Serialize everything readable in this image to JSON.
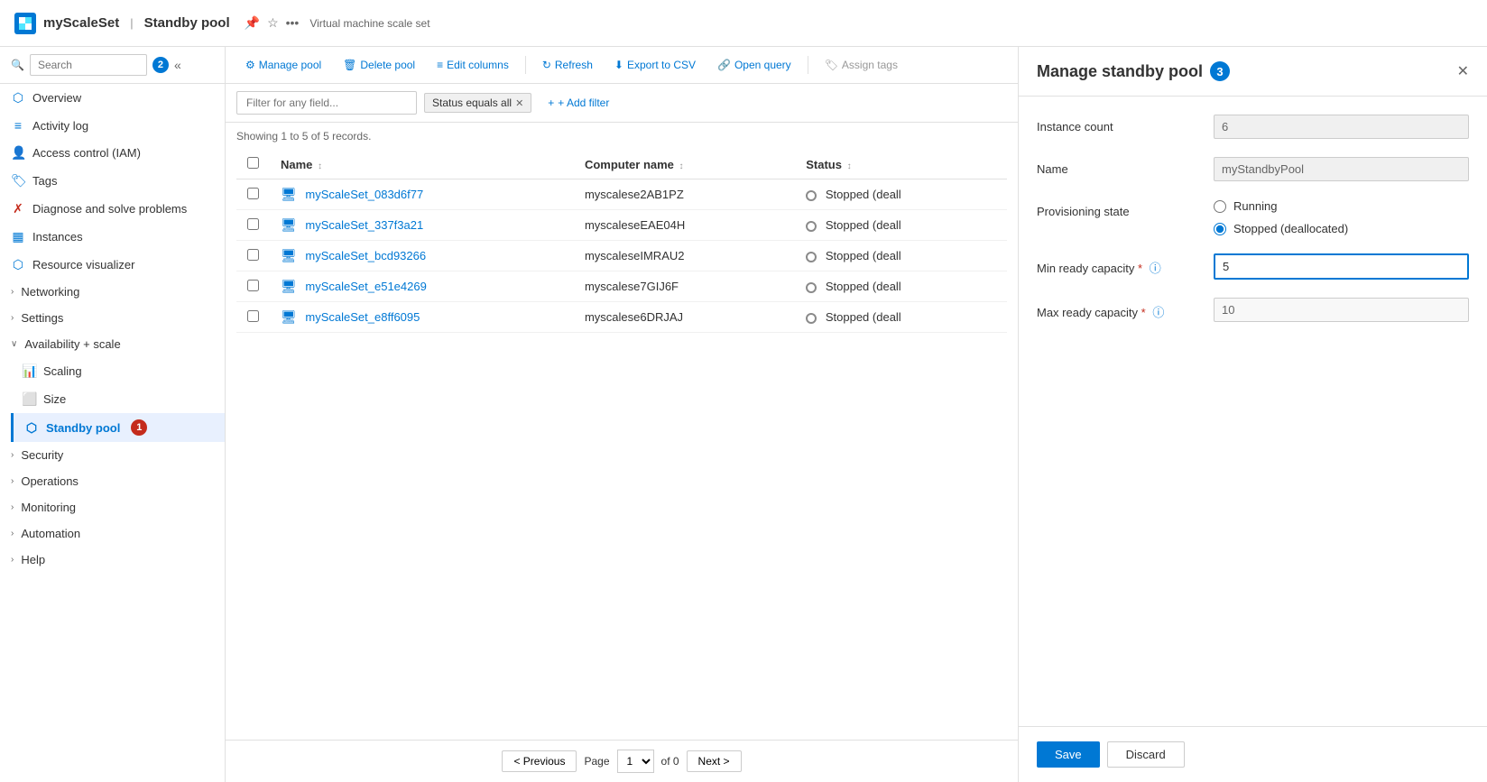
{
  "header": {
    "title": "myScaleSet",
    "separator": "|",
    "section": "Standby pool",
    "subtitle": "Virtual machine scale set",
    "badge2_label": "2"
  },
  "sidebar": {
    "search_placeholder": "Search",
    "nav_items": [
      {
        "id": "overview",
        "label": "Overview",
        "icon": "⬡"
      },
      {
        "id": "activity_log",
        "label": "Activity log",
        "icon": "≡"
      },
      {
        "id": "access_control",
        "label": "Access control (IAM)",
        "icon": "👤"
      },
      {
        "id": "tags",
        "label": "Tags",
        "icon": "🏷"
      },
      {
        "id": "diagnose",
        "label": "Diagnose and solve problems",
        "icon": "✗"
      },
      {
        "id": "instances",
        "label": "Instances",
        "icon": "▦"
      },
      {
        "id": "resource_viz",
        "label": "Resource visualizer",
        "icon": "⬡"
      },
      {
        "id": "networking",
        "label": "Networking",
        "icon": "⬡"
      },
      {
        "id": "settings",
        "label": "Settings",
        "icon": "⬡"
      },
      {
        "id": "availability",
        "label": "Availability + scale",
        "icon": "⬡"
      },
      {
        "id": "scaling",
        "label": "Scaling",
        "icon": "⬡",
        "indent": true
      },
      {
        "id": "size",
        "label": "Size",
        "icon": "⬡",
        "indent": true
      },
      {
        "id": "standby_pool",
        "label": "Standby pool",
        "icon": "⬡",
        "indent": true,
        "active": true,
        "badge": "1"
      },
      {
        "id": "security",
        "label": "Security",
        "icon": "⬡"
      },
      {
        "id": "operations",
        "label": "Operations",
        "icon": "⬡"
      },
      {
        "id": "monitoring",
        "label": "Monitoring",
        "icon": "⬡"
      },
      {
        "id": "automation",
        "label": "Automation",
        "icon": "⬡"
      },
      {
        "id": "help",
        "label": "Help",
        "icon": "⬡"
      }
    ]
  },
  "toolbar": {
    "manage_pool_label": "Manage pool",
    "delete_pool_label": "Delete pool",
    "edit_columns_label": "Edit columns",
    "refresh_label": "Refresh",
    "export_csv_label": "Export to CSV",
    "open_query_label": "Open query",
    "assign_tags_label": "Assign tags"
  },
  "filter": {
    "placeholder": "Filter for any field...",
    "active_filter": "Status equals all",
    "add_filter_label": "+ Add filter"
  },
  "table": {
    "records_text": "Showing 1 to 5 of 5 records.",
    "columns": [
      {
        "id": "name",
        "label": "Name"
      },
      {
        "id": "computer_name",
        "label": "Computer name"
      },
      {
        "id": "status",
        "label": "Status"
      }
    ],
    "rows": [
      {
        "name": "myScaleSet_083d6f77",
        "computer_name": "myscalese2AB1PZ",
        "status": "Stopped (deall"
      },
      {
        "name": "myScaleSet_337f3a21",
        "computer_name": "myscaleseEAE04H",
        "status": "Stopped (deall"
      },
      {
        "name": "myScaleSet_bcd93266",
        "computer_name": "myscaleseIMRAU2",
        "status": "Stopped (deall"
      },
      {
        "name": "myScaleSet_e51e4269",
        "computer_name": "myscalese7GIJ6F",
        "status": "Stopped (deall"
      },
      {
        "name": "myScaleSet_e8ff6095",
        "computer_name": "myscalese6DRJAJ",
        "status": "Stopped (deall"
      }
    ]
  },
  "pagination": {
    "previous_label": "< Previous",
    "next_label": "Next >",
    "page_label": "Page",
    "of_label": "of 0"
  },
  "right_panel": {
    "title": "Manage standby pool",
    "badge3_label": "3",
    "fields": {
      "instance_count_label": "Instance count",
      "instance_count_value": "6",
      "name_label": "Name",
      "name_value": "myStandbyPool",
      "provisioning_state_label": "Provisioning state",
      "radio_running": "Running",
      "radio_stopped": "Stopped (deallocated)",
      "min_ready_label": "Min ready capacity",
      "min_ready_value": "5",
      "max_ready_label": "Max ready capacity",
      "max_ready_value": "10"
    },
    "save_label": "Save",
    "discard_label": "Discard"
  }
}
